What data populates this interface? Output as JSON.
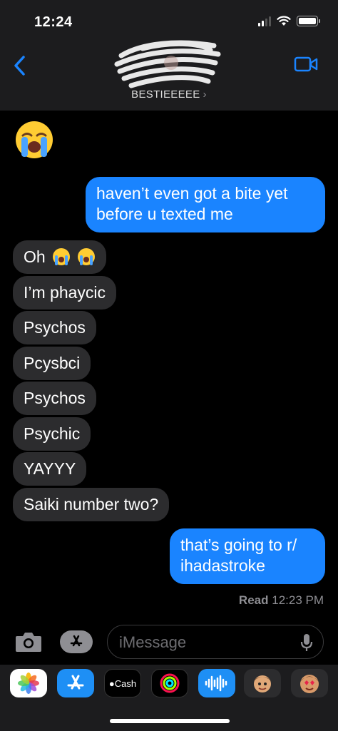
{
  "status_bar": {
    "time": "12:24"
  },
  "header": {
    "contact_name": "BESTIEEEEE",
    "chevron": "›",
    "back_icon": "chevron-left-icon",
    "video_icon": "video-camera-icon"
  },
  "messages": {
    "top_emoji": "loudly-crying-face",
    "outgoing_1": {
      "line1": "haven’t even got a bite yet",
      "line2": "before u texted me"
    },
    "incoming": [
      {
        "text": "Oh",
        "emoji_count": 2
      },
      {
        "text": "I’m phaycic"
      },
      {
        "text": "Psychos"
      },
      {
        "text": "Pcysbci"
      },
      {
        "text": "Psychos"
      },
      {
        "text": "Psychic"
      },
      {
        "text": "YAYYY"
      },
      {
        "text": "Saiki number two?"
      }
    ],
    "outgoing_2": {
      "line1": "that’s going to r/",
      "line2": "ihadastroke"
    },
    "read_receipt": {
      "label": "Read",
      "time": "12:23 PM"
    }
  },
  "input_bar": {
    "placeholder": "iMessage",
    "camera_icon": "camera-icon",
    "apps_icon": "app-store-icon",
    "mic_icon": "microphone-icon"
  },
  "app_drawer": {
    "cash_label": "Cash",
    "apps": [
      "photos",
      "app-store",
      "apple-cash",
      "fitness",
      "audio-message",
      "memoji",
      "animoji"
    ]
  },
  "colors": {
    "outgoing_bubble": "#1a84ff",
    "incoming_bubble": "#2c2c2e",
    "header_bg": "#1c1c1e"
  }
}
